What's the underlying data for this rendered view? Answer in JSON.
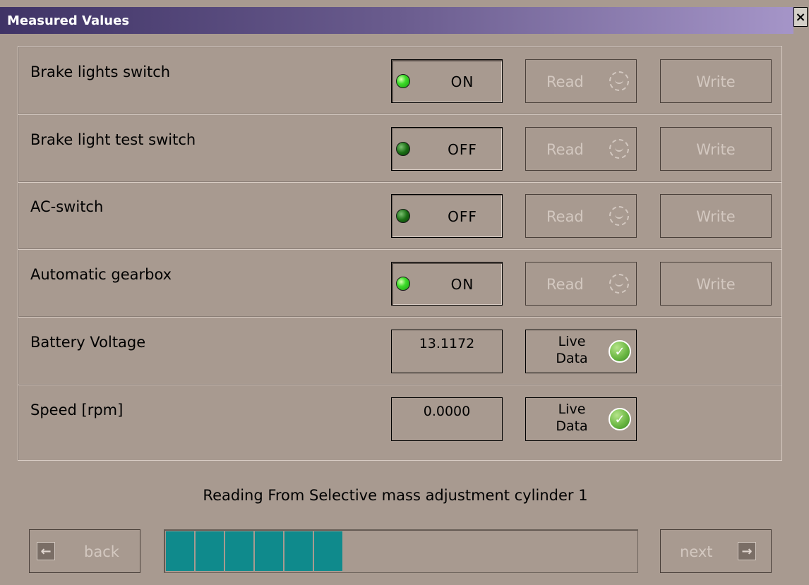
{
  "window": {
    "title": "Measured Values",
    "close_glyph": "×"
  },
  "rows": [
    {
      "label": "Brake lights switch",
      "state": "ON",
      "led": "on",
      "read": "Read",
      "write": "Write"
    },
    {
      "label": "Brake light test switch",
      "state": "OFF",
      "led": "off",
      "read": "Read",
      "write": "Write"
    },
    {
      "label": "AC-switch",
      "state": "OFF",
      "led": "off",
      "read": "Read",
      "write": "Write"
    },
    {
      "label": "Automatic gearbox",
      "state": "ON",
      "led": "on",
      "read": "Read",
      "write": "Write"
    }
  ],
  "values": [
    {
      "label": "Battery Voltage",
      "value": "13.1172",
      "live_line1": "Live",
      "live_line2": "Data"
    },
    {
      "label": "Speed [rpm]",
      "value": "0.0000",
      "live_line1": "Live",
      "live_line2": "Data"
    }
  ],
  "status_text": "Reading From Selective mass adjustment cylinder 1",
  "progress": {
    "filled_segments": 6,
    "total_segments": 16,
    "fraction": 0.37,
    "color": "#0f8a8c"
  },
  "nav": {
    "back_label": "back",
    "next_label": "next",
    "back_icon": "arrow-left-icon",
    "next_icon": "arrow-right-icon"
  },
  "colors": {
    "background": "#a89a90",
    "title_gradient_start": "#3f3366",
    "title_gradient_end": "#a595c8",
    "led_on": "#3ddc2a",
    "led_off": "#1a6e14",
    "disabled_text": "#d3c8c0"
  }
}
